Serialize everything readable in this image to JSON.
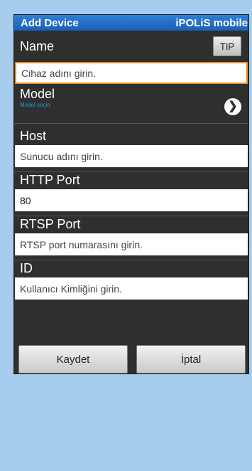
{
  "header": {
    "title": "Add Device",
    "app": "iPOLiS mobile"
  },
  "name": {
    "label": "Name",
    "tip": "TIP",
    "placeholder": "Cihaz adını girin."
  },
  "model": {
    "label": "Model",
    "hint": "Model seçin."
  },
  "host": {
    "label": "Host",
    "placeholder": "Sunucu adını girin."
  },
  "http_port": {
    "label": "HTTP Port",
    "value": "80"
  },
  "rtsp_port": {
    "label": "RTSP Port",
    "placeholder": "RTSP port numarasını girin."
  },
  "id": {
    "label": "ID",
    "placeholder": "Kullanıcı Kimliğini girin."
  },
  "actions": {
    "save": "Kaydet",
    "cancel": "İptal"
  }
}
